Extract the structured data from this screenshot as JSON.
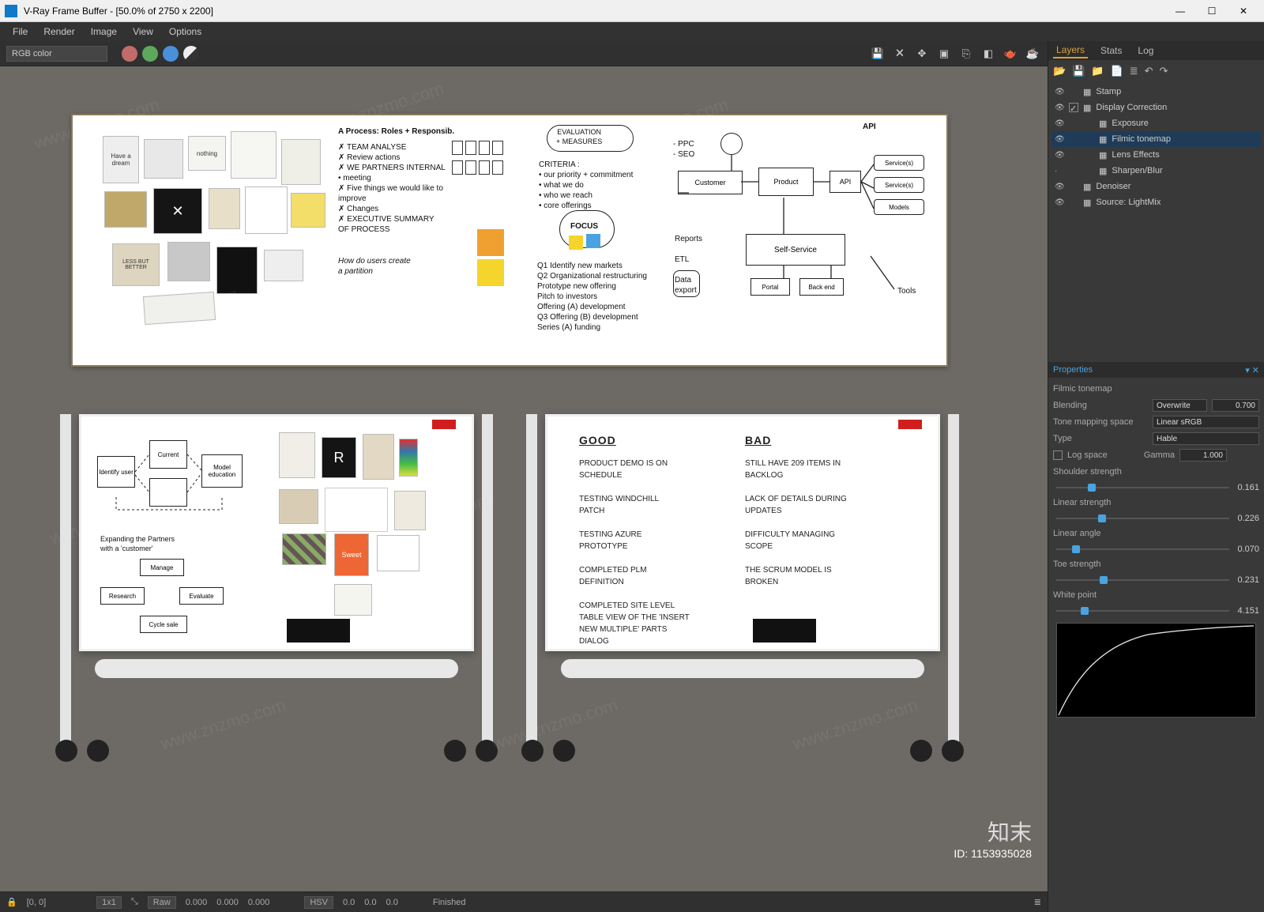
{
  "window": {
    "title": "V-Ray Frame Buffer - [50.0% of 2750 x 2200]"
  },
  "menus": [
    "File",
    "Render",
    "Image",
    "View",
    "Options"
  ],
  "toolbar": {
    "channel": "RGB color",
    "dots": [
      "#c26b6b",
      "#5ea85e",
      "#4a90d8",
      "#cccccc"
    ]
  },
  "status": {
    "coords": "[0, 0]",
    "zoom": "1x1",
    "raw": "Raw",
    "rv0": "0.000",
    "rv1": "0.000",
    "rv2": "0.000",
    "hsv": "HSV",
    "hv0": "0.0",
    "hv1": "0.0",
    "hv2": "0.0",
    "state": "Finished"
  },
  "right": {
    "tabs": [
      "Layers",
      "Stats",
      "Log"
    ],
    "layers": [
      {
        "name": "Stamp",
        "indent": 0,
        "eye": true
      },
      {
        "name": "Display Correction",
        "indent": 0,
        "eye": true,
        "chk": true
      },
      {
        "name": "Exposure",
        "indent": 1,
        "eye": true
      },
      {
        "name": "Filmic tonemap",
        "indent": 1,
        "eye": true,
        "sel": true
      },
      {
        "name": "Lens Effects",
        "indent": 1,
        "eye": true
      },
      {
        "name": "Sharpen/Blur",
        "indent": 1,
        "eye": false
      },
      {
        "name": "Denoiser",
        "indent": 0,
        "eye": true
      },
      {
        "name": "Source: LightMix",
        "indent": 0,
        "eye": true
      }
    ],
    "props": {
      "title": "Properties",
      "header": "Filmic tonemap",
      "blending_label": "Blending",
      "blending_val": "Overwrite",
      "blending_amt": "0.700",
      "tms_label": "Tone mapping space",
      "tms_val": "Linear sRGB",
      "type_label": "Type",
      "type_val": "Hable",
      "log_label": "Log space",
      "gamma_label": "Gamma",
      "gamma": "1.000",
      "sliders": [
        {
          "label": "Shoulder strength",
          "val": "0.161",
          "pct": 18
        },
        {
          "label": "Linear strength",
          "val": "0.226",
          "pct": 24
        },
        {
          "label": "Linear angle",
          "val": "0.070",
          "pct": 9
        },
        {
          "label": "Toe strength",
          "val": "0.231",
          "pct": 25
        },
        {
          "label": "White point",
          "val": "4.151",
          "pct": 14
        }
      ]
    }
  },
  "render": {
    "bigboard": {
      "col1_head": "A Process: Roles + Responsib.",
      "col1_list": "✗ TEAM ANALYSE\n✗ Review actions\n✗ WE PARTNERS INTERNAL\n  • meeting\n✗ Five things we would like to\n  improve\n✗ Changes\n✗ EXECUTIVE SUMMARY\n  OF PROCESS",
      "col1_q": "How do users create\na partition",
      "col2_eval": "EVALUATION\n+ MEASURES",
      "col2_crit": "CRITERIA :\n• our priority + commitment\n• what we do\n• who we reach\n• core offerings",
      "col2_focus": "FOCUS",
      "col2_q": "Q1  Identify new markets\nQ2  Organizational restructuring\n      Prototype new offering\n      Pitch to investors\n      Offering (A) development\nQ3  Offering (B) development\n      Series (A) funding",
      "col3_notes": "- PPC\n- SEO",
      "col3_api": "API",
      "col3_boxes": [
        "Customer",
        "Product",
        "API",
        "Service(s)",
        "Service(s)",
        "Models"
      ],
      "col3_self": "Self-Service",
      "col3_side": "Reports\n\nETL\n\nData\nexport",
      "col3_tools": "Tools"
    },
    "mobile_right": {
      "good_head": "GOOD",
      "good": "PRODUCT DEMO IS ON\nSCHEDULE\n\nTESTING WINDCHILL\nPATCH\n\nTESTING AZURE\nPROTOTYPE\n\nCOMPLETED PLM\nDEFINITION\n\nCOMPLETED SITE LEVEL\nTABLE VIEW OF THE 'INSERT\nNEW MULTIPLE' PARTS\nDIALOG",
      "bad_head": "BAD",
      "bad": "STILL HAVE 209 ITEMS IN\nBACKLOG\n\nLACK OF DETAILS DURING\nUPDATES\n\nDIFFICULTY MANAGING\nSCOPE\n\nTHE SCRUM MODEL IS\nBROKEN"
    },
    "mobile_left": {
      "diag1": [
        "Identify\nuser",
        "Current",
        "Model\neducation"
      ],
      "diag2": "Expanding the Partners\nwith a 'customer'",
      "diag2b": [
        "Manage",
        "Research",
        "Evaluate",
        "Cycle sale"
      ]
    },
    "moodboard_words": [
      "nothing",
      "✕",
      "LESS\nBUT\nBETTER",
      "Have a\ndream"
    ]
  },
  "watermark": {
    "brand": "知末",
    "sub": "ID: 1153935028",
    "repeat": "www.znzmo.com"
  }
}
